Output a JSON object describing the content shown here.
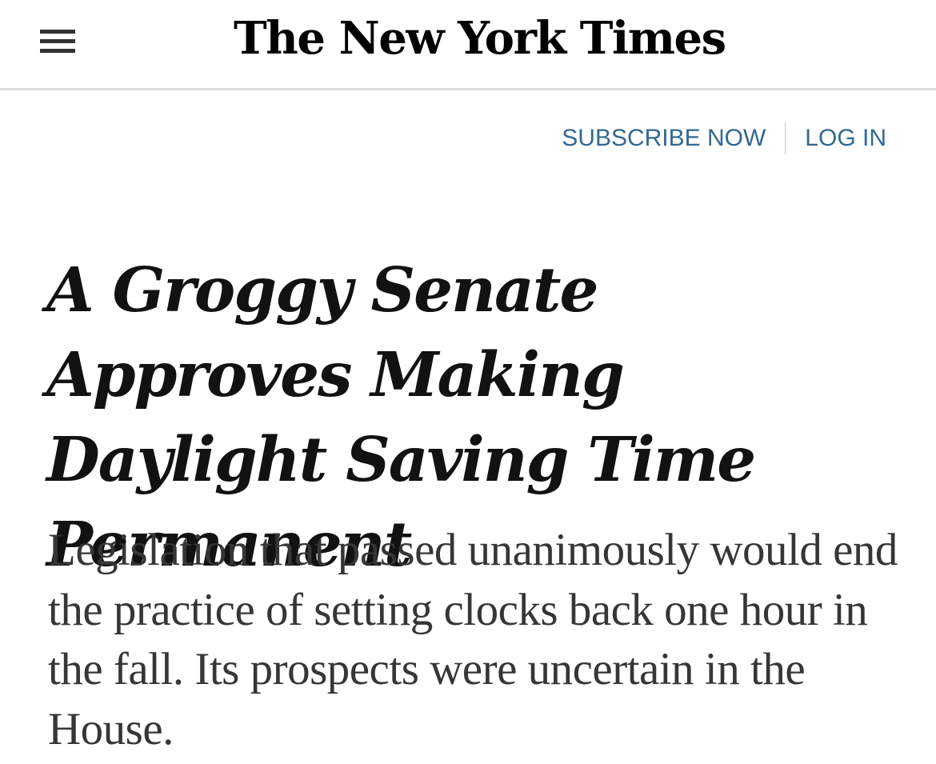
{
  "header": {
    "menu_icon": "hamburger-menu-icon",
    "logo_text": "The New York Times"
  },
  "account": {
    "subscribe_label": "SUBSCRIBE NOW",
    "login_label": "LOG IN"
  },
  "article": {
    "headline": "A Groggy Senate Approves Making Daylight Saving Time Permanent",
    "summary": "Legislation that passed unanimously would end the practice of setting clocks back one hour in the fall. Its prospects were uncertain in the House."
  },
  "colors": {
    "link": "#326891",
    "text": "#121212",
    "summary_text": "#363636",
    "divider": "#dcdcdc"
  }
}
